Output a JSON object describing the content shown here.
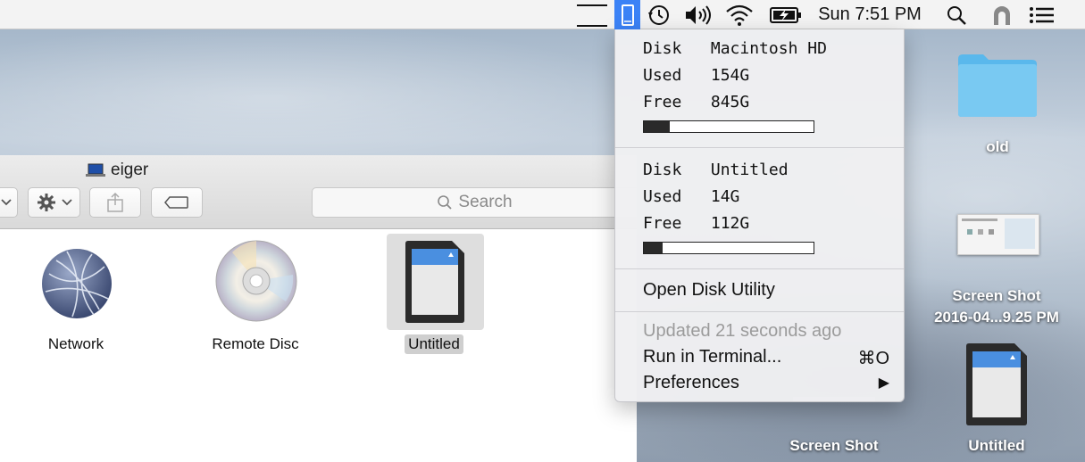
{
  "menubar": {
    "clock": "Sun 7:51 PM",
    "icons": [
      "hamburger-lines-icon",
      "disk-status-icon",
      "time-machine-icon",
      "volume-icon",
      "wifi-icon",
      "battery-icon",
      "spotlight-icon",
      "user-icon",
      "list-icon"
    ]
  },
  "finder": {
    "title": "eiger",
    "search_placeholder": "Search",
    "items": [
      {
        "label": "Network"
      },
      {
        "label": "Remote Disc"
      },
      {
        "label": "Untitled"
      }
    ]
  },
  "disk_menu": {
    "disks": [
      {
        "disk_label": "Disk",
        "disk_name": "Macintosh HD",
        "used_label": "Used",
        "used": "154G",
        "free_label": "Free",
        "free": "845G",
        "used_fraction": 0.154
      },
      {
        "disk_label": "Disk",
        "disk_name": "Untitled",
        "used_label": "Used",
        "used": "14G",
        "free_label": "Free",
        "free": "112G",
        "used_fraction": 0.111
      }
    ],
    "open_disk_utility": "Open Disk Utility",
    "updated": "Updated 21 seconds ago",
    "run_in_terminal": "Run in Terminal...",
    "run_shortcut": "⌘O",
    "preferences": "Preferences",
    "preferences_arrow": "▶"
  },
  "desktop": {
    "icons": [
      {
        "label": "old"
      },
      {
        "label": "Screen Shot",
        "label2": "2016-04...9.25 PM"
      },
      {
        "label": "Screen Shot"
      },
      {
        "label": "Untitled"
      }
    ]
  },
  "colors": {
    "menubar_active": "#3b82f6",
    "folder_blue": "#5ab8ec"
  }
}
